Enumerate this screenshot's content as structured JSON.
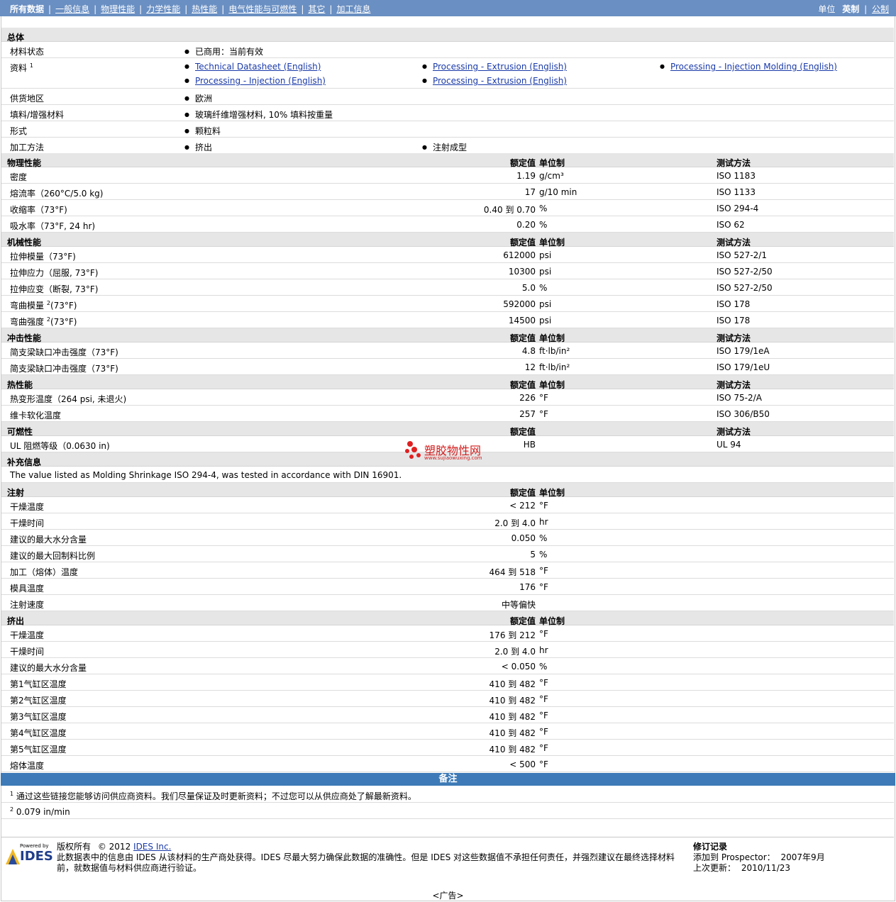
{
  "nav": {
    "items": [
      "所有数据",
      "一般信息",
      "物理性能",
      "力学性能",
      "热性能",
      "电气性能与可燃性",
      "其它",
      "加工信息"
    ],
    "units_label": "单位",
    "units_imperial": "英制",
    "units_metric": "公制"
  },
  "general": {
    "title": "总体",
    "status_label": "材料状态",
    "status_value": "已商用：当前有效",
    "docs_label": "资料",
    "docs_sup": "1",
    "docs": [
      "Technical Datasheet (English)",
      "Processing - Extrusion (English)",
      "Processing - Injection Molding (English)",
      "Processing - Injection (English)",
      "Processing - Extrusion (English)"
    ],
    "region_label": "供货地区",
    "region_value": "欧洲",
    "filler_label": "填料/增强材料",
    "filler_value": "玻璃纤维增强材料, 10% 填料按重量",
    "form_label": "形式",
    "form_value": "颗粒料",
    "method_label": "加工方法",
    "method_values": [
      "挤出",
      "注射成型"
    ]
  },
  "headers": {
    "nominal": "额定值",
    "unit": "单位制",
    "test": "测试方法"
  },
  "physical": {
    "title": "物理性能",
    "rows": [
      {
        "label": "密度",
        "value": "1.19",
        "unit": "g/cm³",
        "test": "ISO 1183"
      },
      {
        "label": "熔流率（260°C/5.0 kg)",
        "value": "17",
        "unit": "g/10 min",
        "test": "ISO 1133"
      },
      {
        "label": "收缩率（73°F)",
        "value": "0.40 到  0.70",
        "unit": "%",
        "test": "ISO 294-4"
      },
      {
        "label": "吸水率（73°F, 24 hr)",
        "value": "0.20",
        "unit": "%",
        "test": "ISO 62"
      }
    ]
  },
  "mechanical": {
    "title": "机械性能",
    "rows": [
      {
        "label": "拉伸模量（73°F)",
        "value": "612000",
        "unit": "psi",
        "test": "ISO 527-2/1"
      },
      {
        "label": "拉伸应力（屈服, 73°F)",
        "value": "10300",
        "unit": "psi",
        "test": "ISO 527-2/50"
      },
      {
        "label": "拉伸应变（断裂, 73°F)",
        "value": "5.0",
        "unit": "%",
        "test": "ISO 527-2/50"
      },
      {
        "label": "弯曲模量",
        "sup": "2",
        "label_tail": "(73°F)",
        "value": "592000",
        "unit": "psi",
        "test": "ISO 178"
      },
      {
        "label": "弯曲强度",
        "sup": "2",
        "label_tail": "(73°F)",
        "value": "14500",
        "unit": "psi",
        "test": "ISO 178"
      }
    ]
  },
  "impact": {
    "title": "冲击性能",
    "rows": [
      {
        "label": "简支梁缺口冲击强度（73°F)",
        "value": "4.8",
        "unit": "ft·lb/in²",
        "test": "ISO 179/1eA"
      },
      {
        "label": "简支梁缺口冲击强度（73°F)",
        "value": "12",
        "unit": "ft·lb/in²",
        "test": "ISO 179/1eU"
      }
    ]
  },
  "thermal": {
    "title": "热性能",
    "rows": [
      {
        "label": "热变形温度（264 psi, 未退火)",
        "value": "226",
        "unit": "°F",
        "test": "ISO 75-2/A"
      },
      {
        "label": "维卡软化温度",
        "value": "257",
        "unit": "°F",
        "test": "ISO 306/B50"
      }
    ]
  },
  "flammability": {
    "title": "可燃性",
    "rows": [
      {
        "label": "UL 阻燃等级（0.0630 in)",
        "value": "HB",
        "unit": "",
        "test": "UL 94"
      }
    ]
  },
  "supplement": {
    "title": "补充信息",
    "text": "The value listed as Molding Shrinkage ISO 294-4, was tested in accordance with DIN 16901."
  },
  "injection": {
    "title": "注射",
    "rows": [
      {
        "label": "干燥温度",
        "value": "< 212",
        "unit": "°F"
      },
      {
        "label": "干燥时间",
        "value": "2.0 到  4.0",
        "unit": "hr"
      },
      {
        "label": "建议的最大水分含量",
        "value": "0.050",
        "unit": "%"
      },
      {
        "label": "建议的最大回制料比例",
        "value": "5",
        "unit": "%"
      },
      {
        "label": "加工（熔体）温度",
        "value": "464 到  518",
        "unit": "°F"
      },
      {
        "label": "模具温度",
        "value": "176",
        "unit": "°F"
      },
      {
        "label": "注射速度",
        "value": "中等偏快",
        "unit": ""
      }
    ]
  },
  "extrusion": {
    "title": "挤出",
    "rows": [
      {
        "label": "干燥温度",
        "value": "176 到  212",
        "unit": "°F"
      },
      {
        "label": "干燥时间",
        "value": "2.0 到  4.0",
        "unit": "hr"
      },
      {
        "label": "建议的最大水分含量",
        "value": "< 0.050",
        "unit": "%"
      },
      {
        "label": "第1气缸区温度",
        "value": "410 到  482",
        "unit": "°F"
      },
      {
        "label": "第2气缸区温度",
        "value": "410 到  482",
        "unit": "°F"
      },
      {
        "label": "第3气缸区温度",
        "value": "410 到  482",
        "unit": "°F"
      },
      {
        "label": "第4气缸区温度",
        "value": "410 到  482",
        "unit": "°F"
      },
      {
        "label": "第5气缸区温度",
        "value": "410 到  482",
        "unit": "°F"
      },
      {
        "label": "熔体温度",
        "value": "< 500",
        "unit": "°F"
      }
    ]
  },
  "notes": {
    "title": "备注",
    "note1_num": "1",
    "note1": "通过这些链接您能够访问供应商资料。我们尽量保证及时更新资料；不过您可以从供应商处了解最新资料。",
    "note2_num": "2",
    "note2": "0.079 in/min"
  },
  "footer": {
    "logo_small": "Powered by",
    "logo_big": "IDES",
    "copyright_label": "版权所有",
    "copyright_year": "© 2012",
    "company": "IDES Inc.",
    "disclaimer": "此数据表中的信息由  IDES 从该材料的生产商处获得。IDES 尽最大努力确保此数据的准确性。但是  IDES 对这些数据值不承担任何责任，并强烈建议在最终选择材料前，就数据值与材料供应商进行验证。",
    "rev_title": "修订记录",
    "added_label": "添加到  Prospector：",
    "added_value": "2007年9月",
    "updated_label": "上次更新：",
    "updated_value": "2010/11/23",
    "ad": "<广告>"
  },
  "watermark": {
    "text": "塑胶物性网",
    "sub": "www.sujiaowuxing.com"
  }
}
